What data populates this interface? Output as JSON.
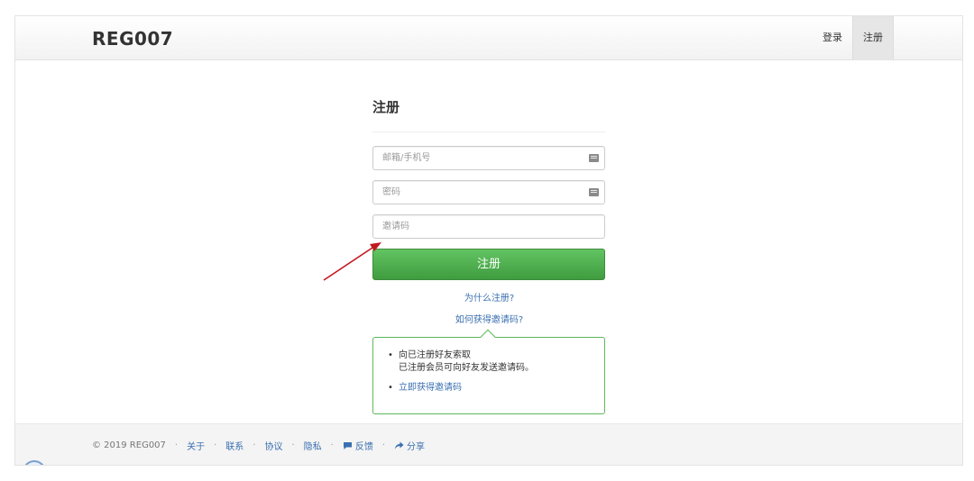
{
  "navbar": {
    "brand": "REG007",
    "login_label": "登录",
    "register_label": "注册"
  },
  "form": {
    "title": "注册",
    "email_placeholder": "邮箱/手机号",
    "password_placeholder": "密码",
    "invite_placeholder": "邀请码",
    "submit_label": "注册",
    "why_link": "为什么注册?",
    "how_link": "如何获得邀请码?"
  },
  "popover": {
    "item1_line1": "向已注册好友索取",
    "item1_line2": "已注册会员可向好友发送邀请码。",
    "item2_link": "立即获得邀请码"
  },
  "footer": {
    "copyright": "© 2019 REG007",
    "separator": "·",
    "about": "关于",
    "contact": "联系",
    "terms": "协议",
    "privacy": "隐私",
    "feedback": "反馈",
    "share": "分享"
  },
  "colors": {
    "primary_button": "#4cae4c",
    "link": "#3a6fb0",
    "popover_border": "#5cb85c",
    "annotation_arrow": "#c0181f"
  },
  "icons": {
    "field_keyboard": "keyboard-icon",
    "feedback": "comment-icon",
    "share": "share-arrow-icon"
  }
}
